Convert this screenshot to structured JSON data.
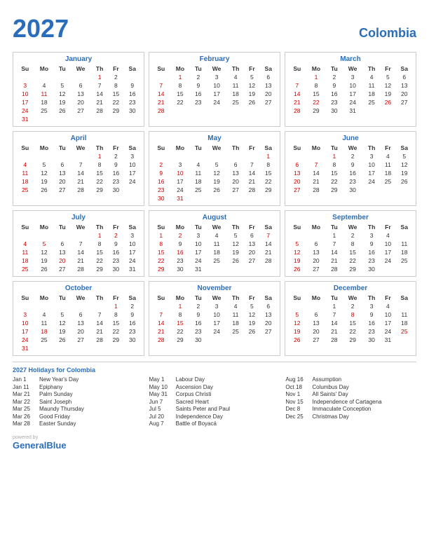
{
  "header": {
    "year": "2027",
    "country": "Colombia"
  },
  "months": [
    {
      "name": "January",
      "days": [
        [
          "",
          "",
          "",
          "",
          "1",
          "2"
        ],
        [
          "3",
          "4",
          "5",
          "6",
          "7",
          "8",
          "9"
        ],
        [
          "10",
          "11",
          "12",
          "13",
          "14",
          "15",
          "16"
        ],
        [
          "17",
          "18",
          "19",
          "20",
          "21",
          "22",
          "23"
        ],
        [
          "24",
          "25",
          "26",
          "27",
          "28",
          "29",
          "30"
        ],
        [
          "31",
          "",
          "",
          "",
          "",
          "",
          ""
        ]
      ],
      "reds": [
        "1",
        "11"
      ],
      "blues": []
    },
    {
      "name": "February",
      "days": [
        [
          "",
          "1",
          "2",
          "3",
          "4",
          "5",
          "6"
        ],
        [
          "7",
          "8",
          "9",
          "10",
          "11",
          "12",
          "13"
        ],
        [
          "14",
          "15",
          "16",
          "17",
          "18",
          "19",
          "20"
        ],
        [
          "21",
          "22",
          "23",
          "24",
          "25",
          "26",
          "27"
        ],
        [
          "28",
          "",
          "",
          "",
          "",
          "",
          ""
        ]
      ],
      "reds": [
        "1"
      ],
      "blues": []
    },
    {
      "name": "March",
      "days": [
        [
          "",
          "1",
          "2",
          "3",
          "4",
          "5",
          "6"
        ],
        [
          "7",
          "8",
          "9",
          "10",
          "11",
          "12",
          "13"
        ],
        [
          "14",
          "15",
          "16",
          "17",
          "18",
          "19",
          "20"
        ],
        [
          "21",
          "22",
          "23",
          "24",
          "25",
          "26",
          "27"
        ],
        [
          "28",
          "29",
          "30",
          "31",
          "",
          "",
          ""
        ]
      ],
      "reds": [
        "1",
        "21",
        "22",
        "26",
        "28"
      ],
      "blues": []
    },
    {
      "name": "April",
      "days": [
        [
          "",
          "",
          "",
          "",
          "1",
          "2",
          "3"
        ],
        [
          "4",
          "5",
          "6",
          "7",
          "8",
          "9",
          "10"
        ],
        [
          "11",
          "12",
          "13",
          "14",
          "15",
          "16",
          "17"
        ],
        [
          "18",
          "19",
          "20",
          "21",
          "22",
          "23",
          "24"
        ],
        [
          "25",
          "26",
          "27",
          "28",
          "29",
          "30",
          ""
        ]
      ],
      "reds": [
        "1"
      ],
      "blues": []
    },
    {
      "name": "May",
      "days": [
        [
          "",
          "",
          "",
          "",
          "",
          "",
          "1"
        ],
        [
          "2",
          "3",
          "4",
          "5",
          "6",
          "7",
          "8"
        ],
        [
          "9",
          "10",
          "11",
          "12",
          "13",
          "14",
          "15"
        ],
        [
          "16",
          "17",
          "18",
          "19",
          "20",
          "21",
          "22"
        ],
        [
          "23",
          "24",
          "25",
          "26",
          "27",
          "28",
          "29"
        ],
        [
          "30",
          "31",
          "",
          "",
          "",
          "",
          ""
        ]
      ],
      "reds": [
        "1",
        "10",
        "31"
      ],
      "blues": []
    },
    {
      "name": "June",
      "days": [
        [
          "",
          "",
          "1",
          "2",
          "3",
          "4",
          "5"
        ],
        [
          "6",
          "7",
          "8",
          "9",
          "10",
          "11",
          "12"
        ],
        [
          "13",
          "14",
          "15",
          "16",
          "17",
          "18",
          "19"
        ],
        [
          "20",
          "21",
          "22",
          "23",
          "24",
          "25",
          "26"
        ],
        [
          "27",
          "28",
          "29",
          "30",
          "",
          "",
          ""
        ]
      ],
      "reds": [
        "1",
        "7"
      ],
      "blues": [
        "7"
      ]
    },
    {
      "name": "July",
      "days": [
        [
          "",
          "",
          "",
          "",
          "1",
          "2",
          "3"
        ],
        [
          "4",
          "5",
          "6",
          "7",
          "8",
          "9",
          "10"
        ],
        [
          "11",
          "12",
          "13",
          "14",
          "15",
          "16",
          "17"
        ],
        [
          "18",
          "19",
          "20",
          "21",
          "22",
          "23",
          "24"
        ],
        [
          "25",
          "26",
          "27",
          "28",
          "29",
          "30",
          "31"
        ]
      ],
      "reds": [
        "1",
        "2",
        "5",
        "20"
      ],
      "blues": []
    },
    {
      "name": "August",
      "days": [
        [
          "1",
          "2",
          "3",
          "4",
          "5",
          "6",
          "7"
        ],
        [
          "8",
          "9",
          "10",
          "11",
          "12",
          "13",
          "14"
        ],
        [
          "15",
          "16",
          "17",
          "18",
          "19",
          "20",
          "21"
        ],
        [
          "22",
          "23",
          "24",
          "25",
          "26",
          "27",
          "28"
        ],
        [
          "29",
          "30",
          "31",
          "",
          "",
          "",
          ""
        ]
      ],
      "reds": [
        "2",
        "7",
        "16"
      ],
      "blues": []
    },
    {
      "name": "September",
      "days": [
        [
          "",
          "",
          "1",
          "2",
          "3",
          "4",
          ""
        ],
        [
          "5",
          "6",
          "7",
          "8",
          "9",
          "10",
          "11"
        ],
        [
          "12",
          "13",
          "14",
          "15",
          "16",
          "17",
          "18"
        ],
        [
          "19",
          "20",
          "21",
          "22",
          "23",
          "24",
          "25"
        ],
        [
          "26",
          "27",
          "28",
          "29",
          "30",
          "",
          ""
        ]
      ],
      "reds": [],
      "blues": []
    },
    {
      "name": "October",
      "days": [
        [
          "",
          "",
          "",
          "",
          "",
          "1",
          "2"
        ],
        [
          "3",
          "4",
          "5",
          "6",
          "7",
          "8",
          "9"
        ],
        [
          "10",
          "11",
          "12",
          "13",
          "14",
          "15",
          "16"
        ],
        [
          "17",
          "18",
          "19",
          "20",
          "21",
          "22",
          "23"
        ],
        [
          "24",
          "25",
          "26",
          "27",
          "28",
          "29",
          "30"
        ],
        [
          "31",
          "",
          "",
          "",
          "",
          "",
          ""
        ]
      ],
      "reds": [
        "1",
        "18"
      ],
      "blues": []
    },
    {
      "name": "November",
      "days": [
        [
          "",
          "1",
          "2",
          "3",
          "4",
          "5",
          "6"
        ],
        [
          "7",
          "8",
          "9",
          "10",
          "11",
          "12",
          "13"
        ],
        [
          "14",
          "15",
          "16",
          "17",
          "18",
          "19",
          "20"
        ],
        [
          "21",
          "22",
          "23",
          "24",
          "25",
          "26",
          "27"
        ],
        [
          "28",
          "29",
          "30",
          "",
          "",
          "",
          ""
        ]
      ],
      "reds": [
        "1",
        "15"
      ],
      "blues": [
        "15"
      ]
    },
    {
      "name": "December",
      "days": [
        [
          "",
          "",
          "1",
          "2",
          "3",
          "4",
          ""
        ],
        [
          "5",
          "6",
          "7",
          "8",
          "9",
          "10",
          "11"
        ],
        [
          "12",
          "13",
          "14",
          "15",
          "16",
          "17",
          "18"
        ],
        [
          "19",
          "20",
          "21",
          "22",
          "23",
          "24",
          "25"
        ],
        [
          "26",
          "27",
          "28",
          "29",
          "30",
          "31",
          ""
        ]
      ],
      "reds": [
        "8",
        "25"
      ],
      "blues": [
        "8"
      ]
    }
  ],
  "holidays_title": "2027 Holidays for Colombia",
  "holidays": [
    [
      {
        "date": "Jan 1",
        "name": "New Year's Day"
      },
      {
        "date": "Jan 11",
        "name": "Epiphany"
      },
      {
        "date": "Mar 21",
        "name": "Palm Sunday"
      },
      {
        "date": "Mar 22",
        "name": "Saint Joseph"
      },
      {
        "date": "Mar 25",
        "name": "Maundy Thursday"
      },
      {
        "date": "Mar 26",
        "name": "Good Friday"
      },
      {
        "date": "Mar 28",
        "name": "Easter Sunday"
      }
    ],
    [
      {
        "date": "May 1",
        "name": "Labour Day"
      },
      {
        "date": "May 10",
        "name": "Ascension Day"
      },
      {
        "date": "May 31",
        "name": "Corpus Christi"
      },
      {
        "date": "Jun 7",
        "name": "Sacred Heart"
      },
      {
        "date": "Jul 5",
        "name": "Saints Peter and Paul"
      },
      {
        "date": "Jul 20",
        "name": "Independence Day"
      },
      {
        "date": "Aug 7",
        "name": "Battle of Boyacá"
      }
    ],
    [
      {
        "date": "Aug 16",
        "name": "Assumption"
      },
      {
        "date": "Oct 18",
        "name": "Columbus Day"
      },
      {
        "date": "Nov 1",
        "name": "All Saints' Day"
      },
      {
        "date": "Nov 15",
        "name": "Independence of Cartagena"
      },
      {
        "date": "Dec 8",
        "name": "Immaculate Conception"
      },
      {
        "date": "Dec 25",
        "name": "Christmas Day"
      }
    ]
  ],
  "footer": {
    "powered_by": "powered by",
    "brand_general": "General",
    "brand_blue": "Blue"
  },
  "weekdays": [
    "Su",
    "Mo",
    "Tu",
    "We",
    "Th",
    "Fr",
    "Sa"
  ]
}
